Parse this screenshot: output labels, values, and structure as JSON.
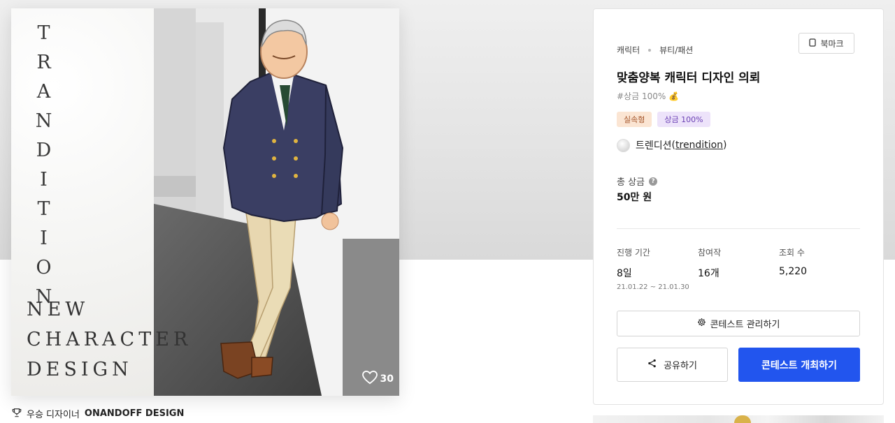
{
  "artwork": {
    "vertical_title": "TRANDITION",
    "caption": "NEW\nCHARACTER\nDESIGN",
    "likes": "30"
  },
  "winner": {
    "prefix": "우승 디자이너",
    "name": "ONANDOFF DESIGN"
  },
  "panel": {
    "category": "캐릭터",
    "subcategory": "뷰티/패션",
    "bookmark_label": "북마크",
    "title": "맞춤양복 캐릭터 디자인 의뢰",
    "hashtag": "#상금 100% 💰",
    "tags": [
      "실속형",
      "상금 100%"
    ],
    "host_name": "트렌디션",
    "host_id": "trendition",
    "prize_label": "총 상금",
    "prize_value": "50만 원",
    "stats": {
      "period_label": "진행 기간",
      "period_value": "8일",
      "period_range": "21.01.22 ~ 21.01.30",
      "participants_label": "참여작",
      "participants_value": "16개",
      "views_label": "조회 수",
      "views_value": "5,220"
    },
    "manage_label": "콘테스트 관리하기",
    "share_label": "공유하기",
    "host_button_label": "콘테스트 개최하기"
  },
  "colors": {
    "primary": "#2255ee",
    "tag_type_bg": "#fbe5d3",
    "tag_prize_bg": "#ede3fa"
  },
  "icons": [
    "heart-icon",
    "trophy-icon",
    "bookmark-icon",
    "info-icon",
    "gear-icon",
    "share-icon"
  ]
}
